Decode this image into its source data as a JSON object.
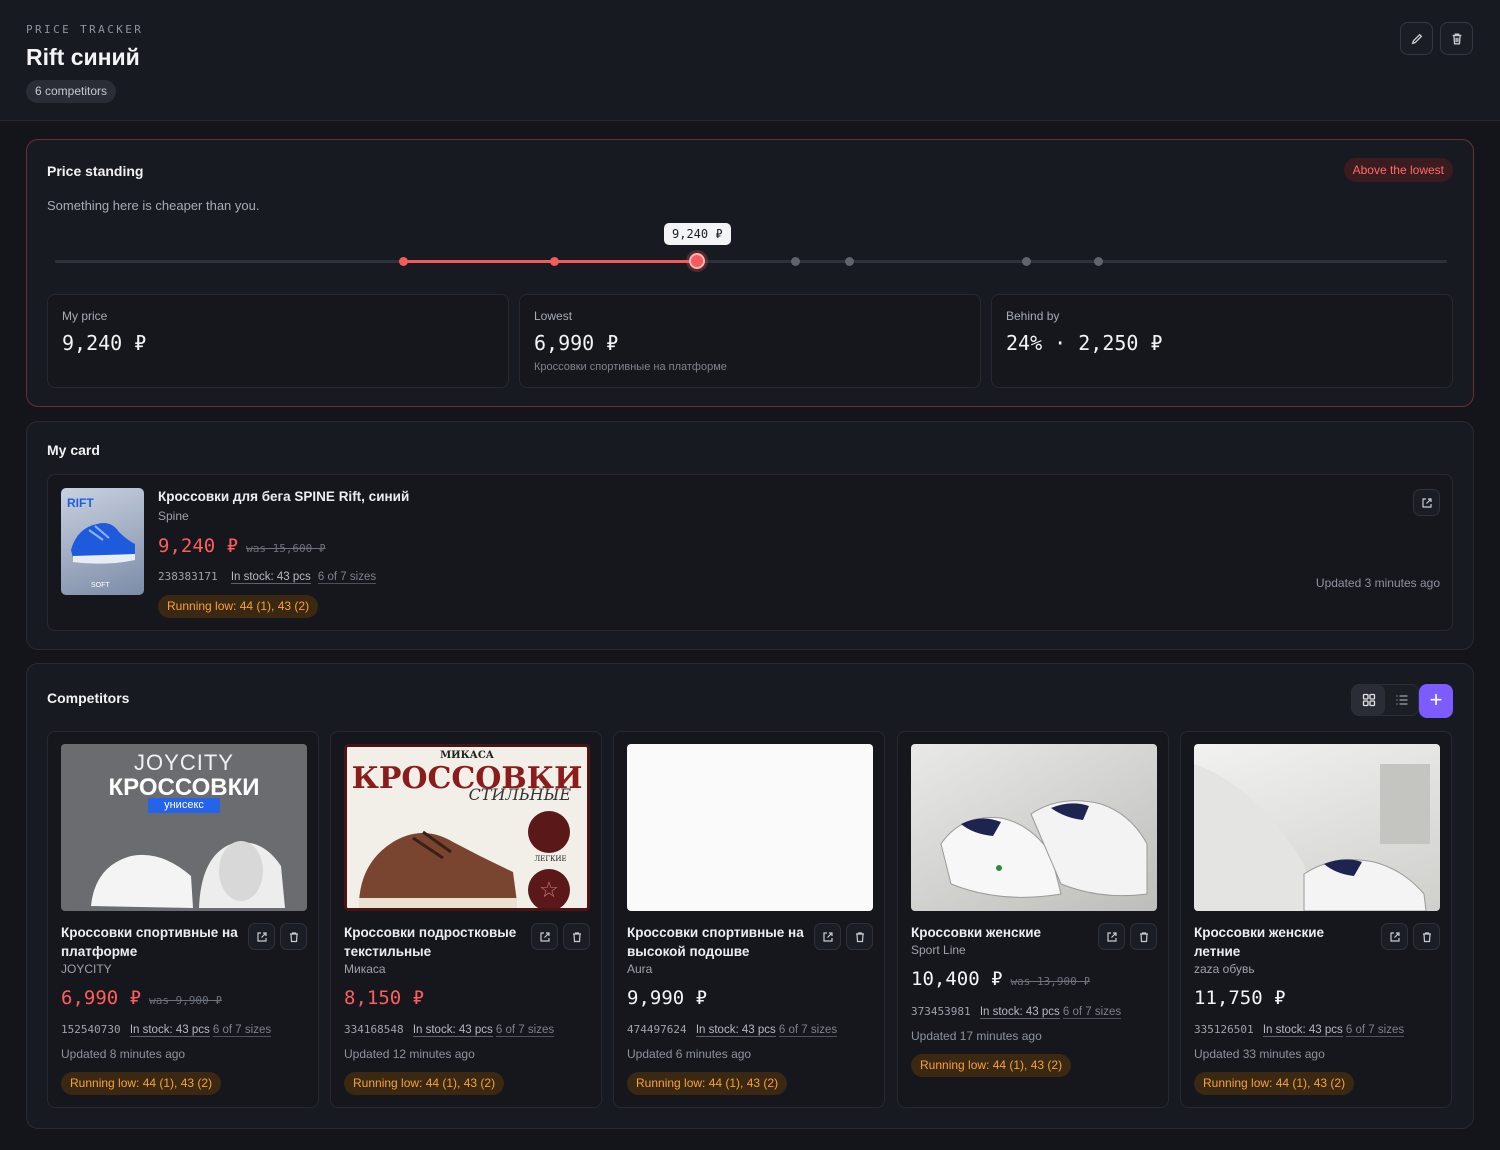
{
  "header": {
    "eyebrow": "PRICE TRACKER",
    "title": "Rift синий",
    "competitor_count": "6 competitors"
  },
  "standing": {
    "title": "Price standing",
    "badge": "Above the lowest",
    "subtitle": "Something here is cheaper than you.",
    "my_price_tip": "9,240 ₽",
    "stats": [
      {
        "label": "My price",
        "value": "9,240 ₽",
        "note": ""
      },
      {
        "label": "Lowest",
        "value": "6,990 ₽",
        "note": "Кроссовки спортивные на платформе"
      },
      {
        "label": "Behind by",
        "value": "24% · 2,250 ₽",
        "note": ""
      }
    ]
  },
  "my_card": {
    "title": "My card",
    "name": "Кроссовки для бега SPINE Rift, синий",
    "brand": "Spine",
    "price": "9,240 ₽",
    "was": "was 15,600 ₽",
    "sku": "238383171",
    "stock": "In stock: 43 pcs",
    "sizes": "6 of 7 sizes",
    "updated": "Updated 3 minutes ago",
    "running_low": "Running low: 44 (1), 43 (2)",
    "thumb_label_top": "RIFT",
    "thumb_label_bottom": "SOFT"
  },
  "competitors": {
    "title": "Competitors",
    "add_label": "+",
    "items": [
      {
        "name": "Кроссовки спортивные на платформе",
        "brand": "JOYCITY",
        "price": "6,990 ₽",
        "was": "was 9,900 ₽",
        "sku": "152540730",
        "stock": "In stock: 43 pcs",
        "sizes": "6 of 7 sizes",
        "updated": "Updated 8 minutes ago",
        "running_low": "Running low: 44 (1), 43 (2)",
        "img_line1": "JOYCITY",
        "img_line2": "КРОССОВКИ",
        "img_line3": "унисекс"
      },
      {
        "name": "Кроссовки подростковые текстильные",
        "brand": "Микаса",
        "price": "8,150 ₽",
        "was": "",
        "sku": "334168548",
        "stock": "In stock: 43 pcs",
        "sizes": "6 of 7 sizes",
        "updated": "Updated 12 minutes ago",
        "running_low": "Running low: 44 (1), 43 (2)",
        "img_line1": "МИКАСА",
        "img_line2": "КРОССОВКИ",
        "img_line3": "СТИЛЬНЫЕ",
        "img_line4": "ЛЕГКИЕ"
      },
      {
        "name": "Кроссовки спортивные на высокой подошве",
        "brand": "Aura",
        "price": "9,990 ₽",
        "was": "",
        "sku": "474497624",
        "stock": "In stock: 43 pcs",
        "sizes": "6 of 7 sizes",
        "updated": "Updated 6 minutes ago",
        "running_low": "Running low: 44 (1), 43 (2)"
      },
      {
        "name": "Кроссовки женские",
        "brand": "Sport Line",
        "price": "10,400 ₽",
        "was": "was 13,900 ₽",
        "sku": "373453981",
        "stock": "In stock: 43 pcs",
        "sizes": "6 of 7 sizes",
        "updated": "Updated 17 minutes ago",
        "running_low": "Running low: 44 (1), 43 (2)"
      },
      {
        "name": "Кроссовки женские летние",
        "brand": "zaza обувь",
        "price": "11,750 ₽",
        "was": "",
        "sku": "335126501",
        "stock": "In stock: 43 pcs",
        "sizes": "6 of 7 sizes",
        "updated": "Updated 33 minutes ago",
        "running_low": "Running low: 44 (1), 43 (2)"
      }
    ]
  },
  "colors": {
    "accent_red": "#f45b5b",
    "accent_purple": "#7c5cff",
    "warning_orange": "#f6a23b"
  }
}
